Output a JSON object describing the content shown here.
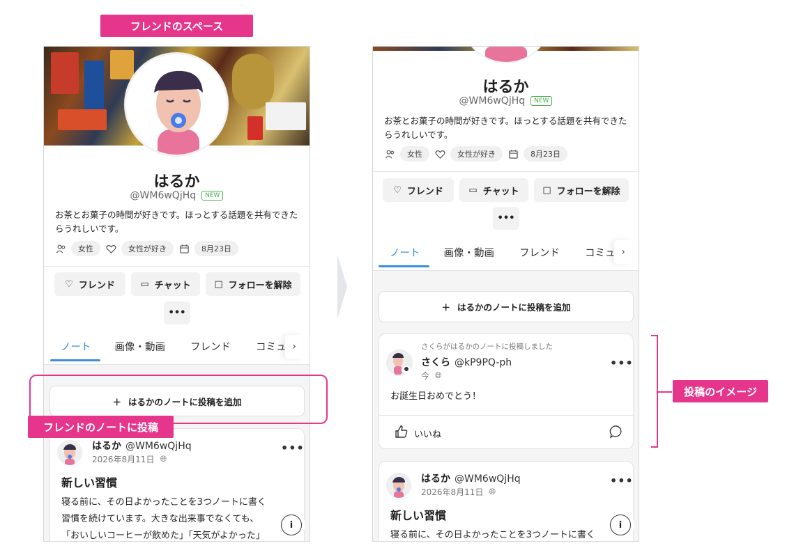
{
  "callouts": {
    "friend_space": "フレンドのスペース",
    "friend_note_post": "フレンドのノートに投稿",
    "post_image": "投稿のイメージ"
  },
  "profile": {
    "name": "はるか",
    "handle": "@WM6wQjHq",
    "badge": "NEW",
    "bio_line1": "お茶とお菓子の時間が好きです。ほっとする話題を共有できた",
    "bio_line2": "らうれしいです。",
    "tags": [
      "女性",
      "女性が好き",
      "8月23日"
    ]
  },
  "actions": {
    "friend": "フレンド",
    "chat": "チャット",
    "unfollow": "フォローを解除",
    "more": "•••"
  },
  "tabs": [
    "ノート",
    "画像・動画",
    "フレンド",
    "コミュニ"
  ],
  "add_note_label": "はるかのノートに投稿を追加",
  "friend_post": {
    "context": "さくらがはるかのノートに投稿しました",
    "author": "さくら",
    "handle": "@kP9PQ-ph",
    "time": "今",
    "body": "お誕生日おめでとう！",
    "like_label": "いいね"
  },
  "own_post": {
    "author": "はるか",
    "handle": "@WM6wQjHq",
    "date": "2026年8月11日",
    "title": "新しい習慣",
    "body_lines": [
      "寝る前に、その日よかったことを3つノートに書く",
      "習慣を続けています。大きな出来事でなくても、",
      "「おいしいコーヒーが飲めた」「天気がよかった」"
    ]
  },
  "colors": {
    "accent_pink": "#e5368c",
    "tab_blue": "#3a8fd6"
  }
}
